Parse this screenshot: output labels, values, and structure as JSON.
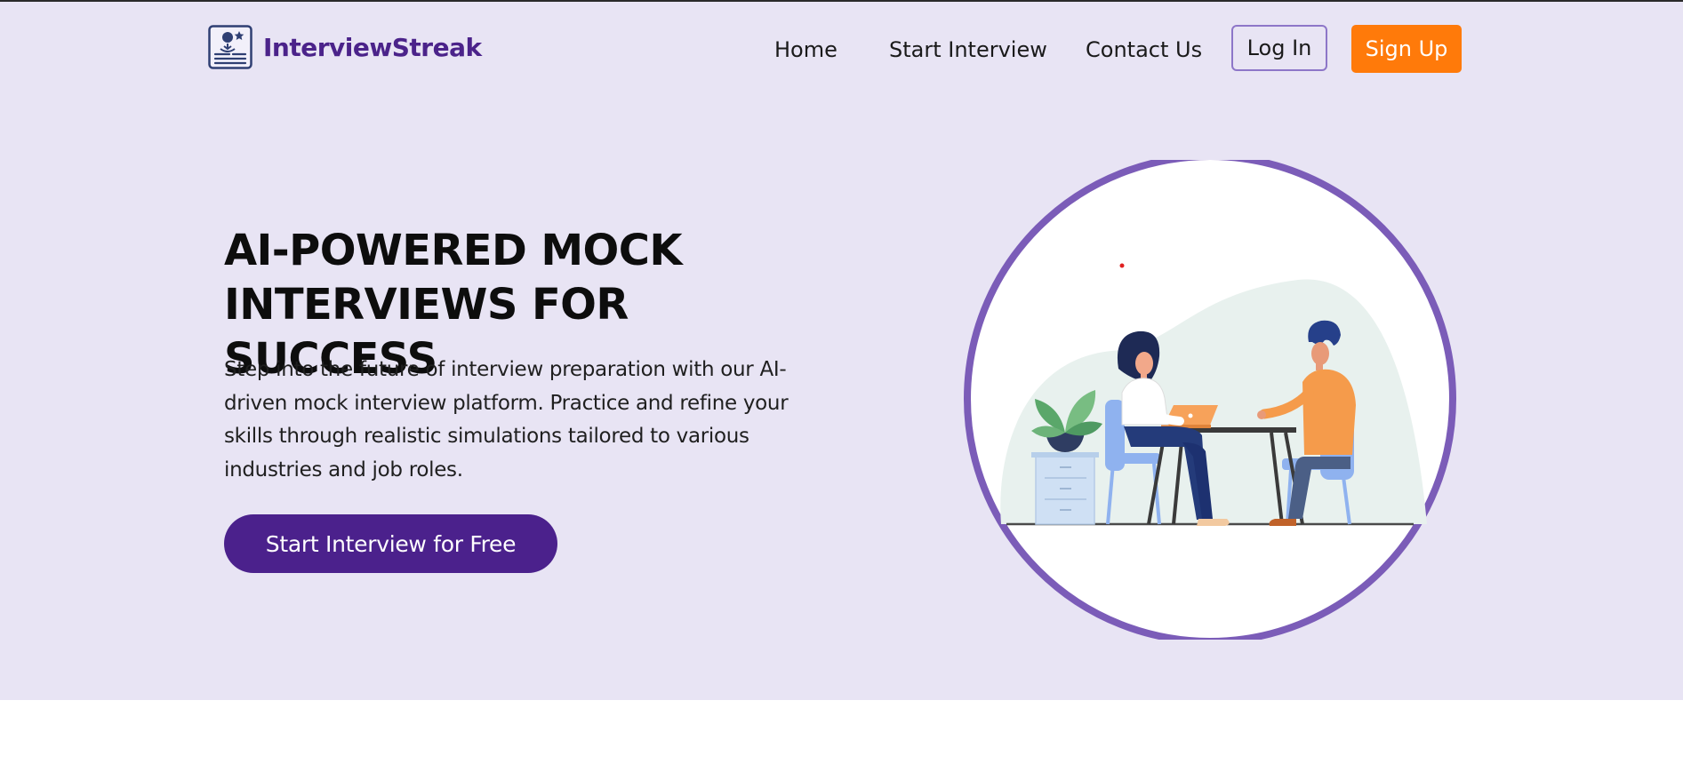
{
  "brand": {
    "name": "InterviewStreak",
    "color": "#4b238a"
  },
  "nav": {
    "links": [
      {
        "label": "Home"
      },
      {
        "label": "Start Interview"
      },
      {
        "label": "Contact Us"
      }
    ],
    "login_label": "Log In",
    "signup_label": "Sign Up"
  },
  "hero": {
    "title": "AI-POWERED MOCK INTERVIEWS FOR SUCCESS",
    "description": "Step into the future of interview preparation with our AI-driven mock interview platform. Practice and refine your skills through realistic simulations tailored to various industries and job roles.",
    "cta_label": "Start Interview for Free"
  },
  "colors": {
    "hero_bg": "#e8e4f4",
    "accent_purple": "#4b218c",
    "signup_orange": "#ff7a0a",
    "circle_border": "#7b5cb8"
  },
  "icons": {
    "logo": "interview-logo-icon",
    "illustration": "interview-illustration"
  }
}
